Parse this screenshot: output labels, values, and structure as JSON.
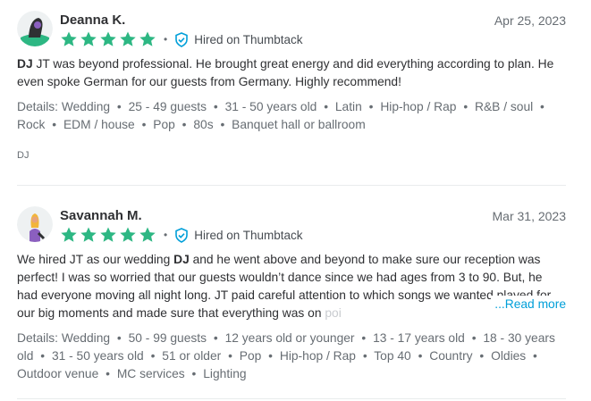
{
  "reviews": [
    {
      "name": "Deanna K.",
      "date": "Apr 25, 2023",
      "stars": 5,
      "hired_label": "Hired on Thumbtack",
      "text_lead": "DJ",
      "text_rest": " JT was beyond professional. He brought great energy and did everything according to plan. He even spoke German for our guests from Germany. Highly recommend!",
      "details_label": "Details:",
      "details": [
        "Wedding",
        "25 - 49 guests",
        "31 - 50 years old",
        "Latin",
        "Hip-hop / Rap",
        "R&B / soul",
        "Rock",
        "EDM / house",
        "Pop",
        "80s",
        "Banquet hall or ballroom"
      ],
      "tag": "DJ"
    },
    {
      "name": "Savannah M.",
      "date": "Mar 31, 2023",
      "stars": 5,
      "hired_label": "Hired on Thumbtack",
      "text_pre": "We hired JT as our wedding ",
      "text_bold": "DJ",
      "text_post": " and he went above and beyond to make sure our reception was perfect! I was so worried that our guests wouldn’t dance since we had ages from 3 to 90. But, he had everyone moving all night long. JT paid careful attention to which songs we wanted played for our big moments and made sure that everything was on ",
      "text_fade": "poi",
      "read_more": "...Read more",
      "details_label": "Details:",
      "details": [
        "Wedding",
        "50 - 99 guests",
        "12 years old or younger",
        "13 - 17 years old",
        "18 - 30 years old",
        "31 - 50 years old",
        "51 or older",
        "Pop",
        "Hip-hop / Rap",
        "Top 40",
        "Country",
        "Oldies",
        "Outdoor venue",
        "MC services",
        "Lighting"
      ]
    }
  ],
  "colors": {
    "star": "#2db783",
    "badge": "#009fd9",
    "link": "#009fd9"
  },
  "icons": {
    "star": "star-icon",
    "badge": "shield-check-icon"
  }
}
